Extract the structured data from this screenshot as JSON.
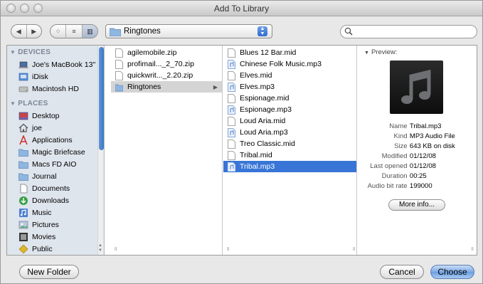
{
  "window": {
    "title": "Add To Library"
  },
  "toolbar": {
    "path_label": "Ringtones",
    "search": {
      "value": "",
      "placeholder": ""
    }
  },
  "sidebar": {
    "devices_header": "DEVICES",
    "devices": [
      "Joe's MacBook 13\"",
      "iDisk",
      "Macintosh HD"
    ],
    "places_header": "PLACES",
    "places": [
      "Desktop",
      "joe",
      "Applications",
      "Magic Briefcase",
      "Macs FD AIO",
      "Journal",
      "Documents",
      "Downloads",
      "Music",
      "Pictures",
      "Movies",
      "Public"
    ]
  },
  "column1": {
    "items": [
      "agilemobile.zip",
      "profimail..._2_70.zip",
      "quickwrit..._2.20.zip",
      "Ringtones"
    ],
    "selected": "Ringtones"
  },
  "column2": {
    "items": [
      "Blues 12 Bar.mid",
      "Chinese Folk Music.mp3",
      "Elves.mid",
      "Elves.mp3",
      "Espionage.mid",
      "Espionage.mp3",
      "Loud Aria.mid",
      "Loud Aria.mp3",
      "Treo Classic.mid",
      "Tribal.mid",
      "Tribal.mp3"
    ],
    "selected": "Tribal.mp3"
  },
  "preview": {
    "label": "Preview:",
    "info": [
      {
        "key": "Name",
        "value": "Tribal.mp3"
      },
      {
        "key": "Kind",
        "value": "MP3 Audio File"
      },
      {
        "key": "Size",
        "value": "643 KB on disk"
      },
      {
        "key": "Modified",
        "value": "01/12/08"
      },
      {
        "key": "Last opened",
        "value": "01/12/08"
      },
      {
        "key": "Duration",
        "value": "00:25"
      },
      {
        "key": "Audio bit rate",
        "value": "199000"
      }
    ],
    "more_info_label": "More info..."
  },
  "buttons": {
    "new_folder": "New Folder",
    "cancel": "Cancel",
    "choose": "Choose"
  }
}
